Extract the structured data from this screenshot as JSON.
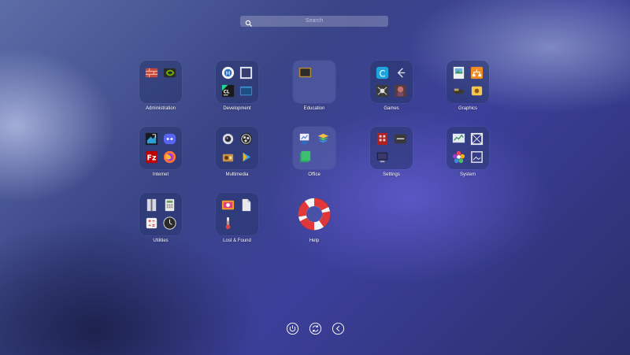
{
  "search": {
    "placeholder": "Search"
  },
  "apps": [
    {
      "name": "Administration"
    },
    {
      "name": "Development"
    },
    {
      "name": "Education"
    },
    {
      "name": "Games"
    },
    {
      "name": "Graphics"
    },
    {
      "name": "Internet"
    },
    {
      "name": "Multimedia"
    },
    {
      "name": "Office"
    },
    {
      "name": "Settings"
    },
    {
      "name": "System"
    },
    {
      "name": "Utilities"
    },
    {
      "name": "Lost & Found"
    },
    {
      "name": "Help"
    }
  ],
  "bottom_actions": [
    "power-icon",
    "refresh-icon",
    "back-icon"
  ]
}
